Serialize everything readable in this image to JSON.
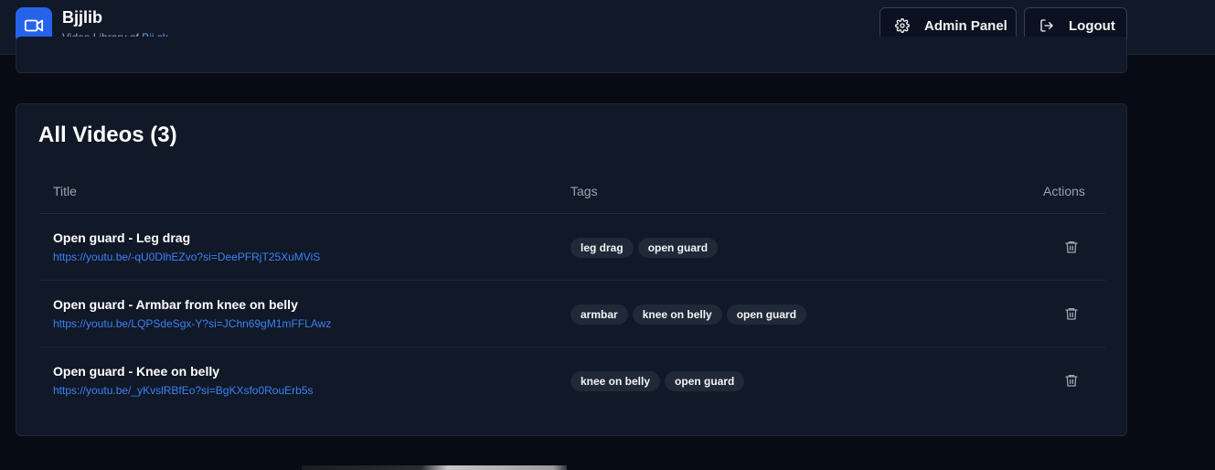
{
  "brand": {
    "name": "Bjjlib",
    "subtitle_prefix": "Video Library of",
    "subtitle_link": "Bjj.sk",
    "logo_icon": "video-camera-icon",
    "accent": "#2563eb"
  },
  "header": {
    "admin_label": "Admin Panel",
    "admin_icon": "gear-icon",
    "logout_label": "Logout",
    "logout_icon": "logout-icon"
  },
  "videos": {
    "title": "All Videos (3)",
    "columns": {
      "title": "Title",
      "tags": "Tags",
      "actions": "Actions"
    },
    "rows": [
      {
        "title": "Open guard - Leg drag",
        "url": "https://youtu.be/-qU0DlhEZvo?si=DeePFRjT25XuMViS",
        "tags": [
          "leg drag",
          "open guard"
        ]
      },
      {
        "title": "Open guard - Armbar from knee on belly",
        "url": "https://youtu.be/LQPSdeSgx-Y?si=JChn69gM1mFFLAwz",
        "tags": [
          "armbar",
          "knee on belly",
          "open guard"
        ]
      },
      {
        "title": "Open guard - Knee on belly",
        "url": "https://youtu.be/_yKvslRBfEo?si=BgKXsfo0RouErb5s",
        "tags": [
          "knee on belly",
          "open guard"
        ]
      }
    ],
    "delete_icon": "trash-icon"
  }
}
